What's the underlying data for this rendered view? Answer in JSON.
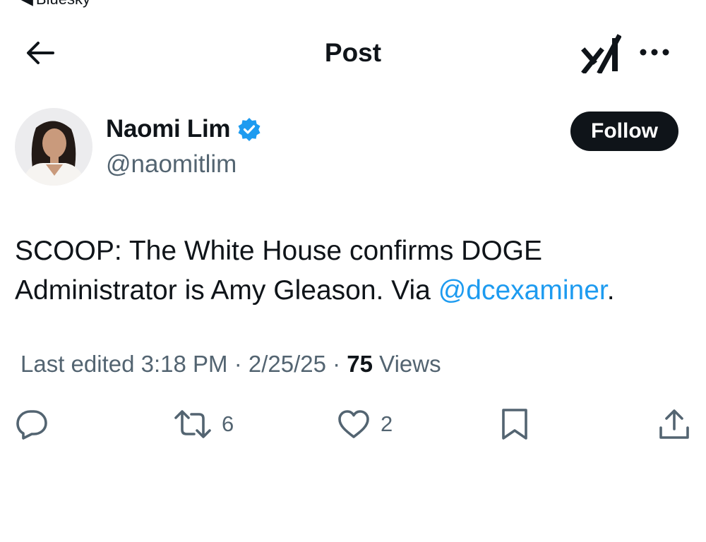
{
  "status_bar": {
    "back_app_label": "Bluesky"
  },
  "header": {
    "title": "Post"
  },
  "author": {
    "display_name": "Naomi Lim",
    "handle": "@naomitlim",
    "follow_label": "Follow"
  },
  "tweet": {
    "text_before": "SCOOP: The White House confirms DOGE Administrator is Amy Gleason. Via ",
    "mention": "@dcexaminer",
    "text_after": "."
  },
  "meta": {
    "edited_label": "Last edited 3:18 PM · 2/25/25",
    "separator": " · ",
    "views_count": "75",
    "views_label": "Views"
  },
  "actions": {
    "reposts": "6",
    "likes": "2"
  },
  "colors": {
    "accent": "#1d9bf0",
    "text": "#0f1419",
    "secondary": "#536471"
  }
}
